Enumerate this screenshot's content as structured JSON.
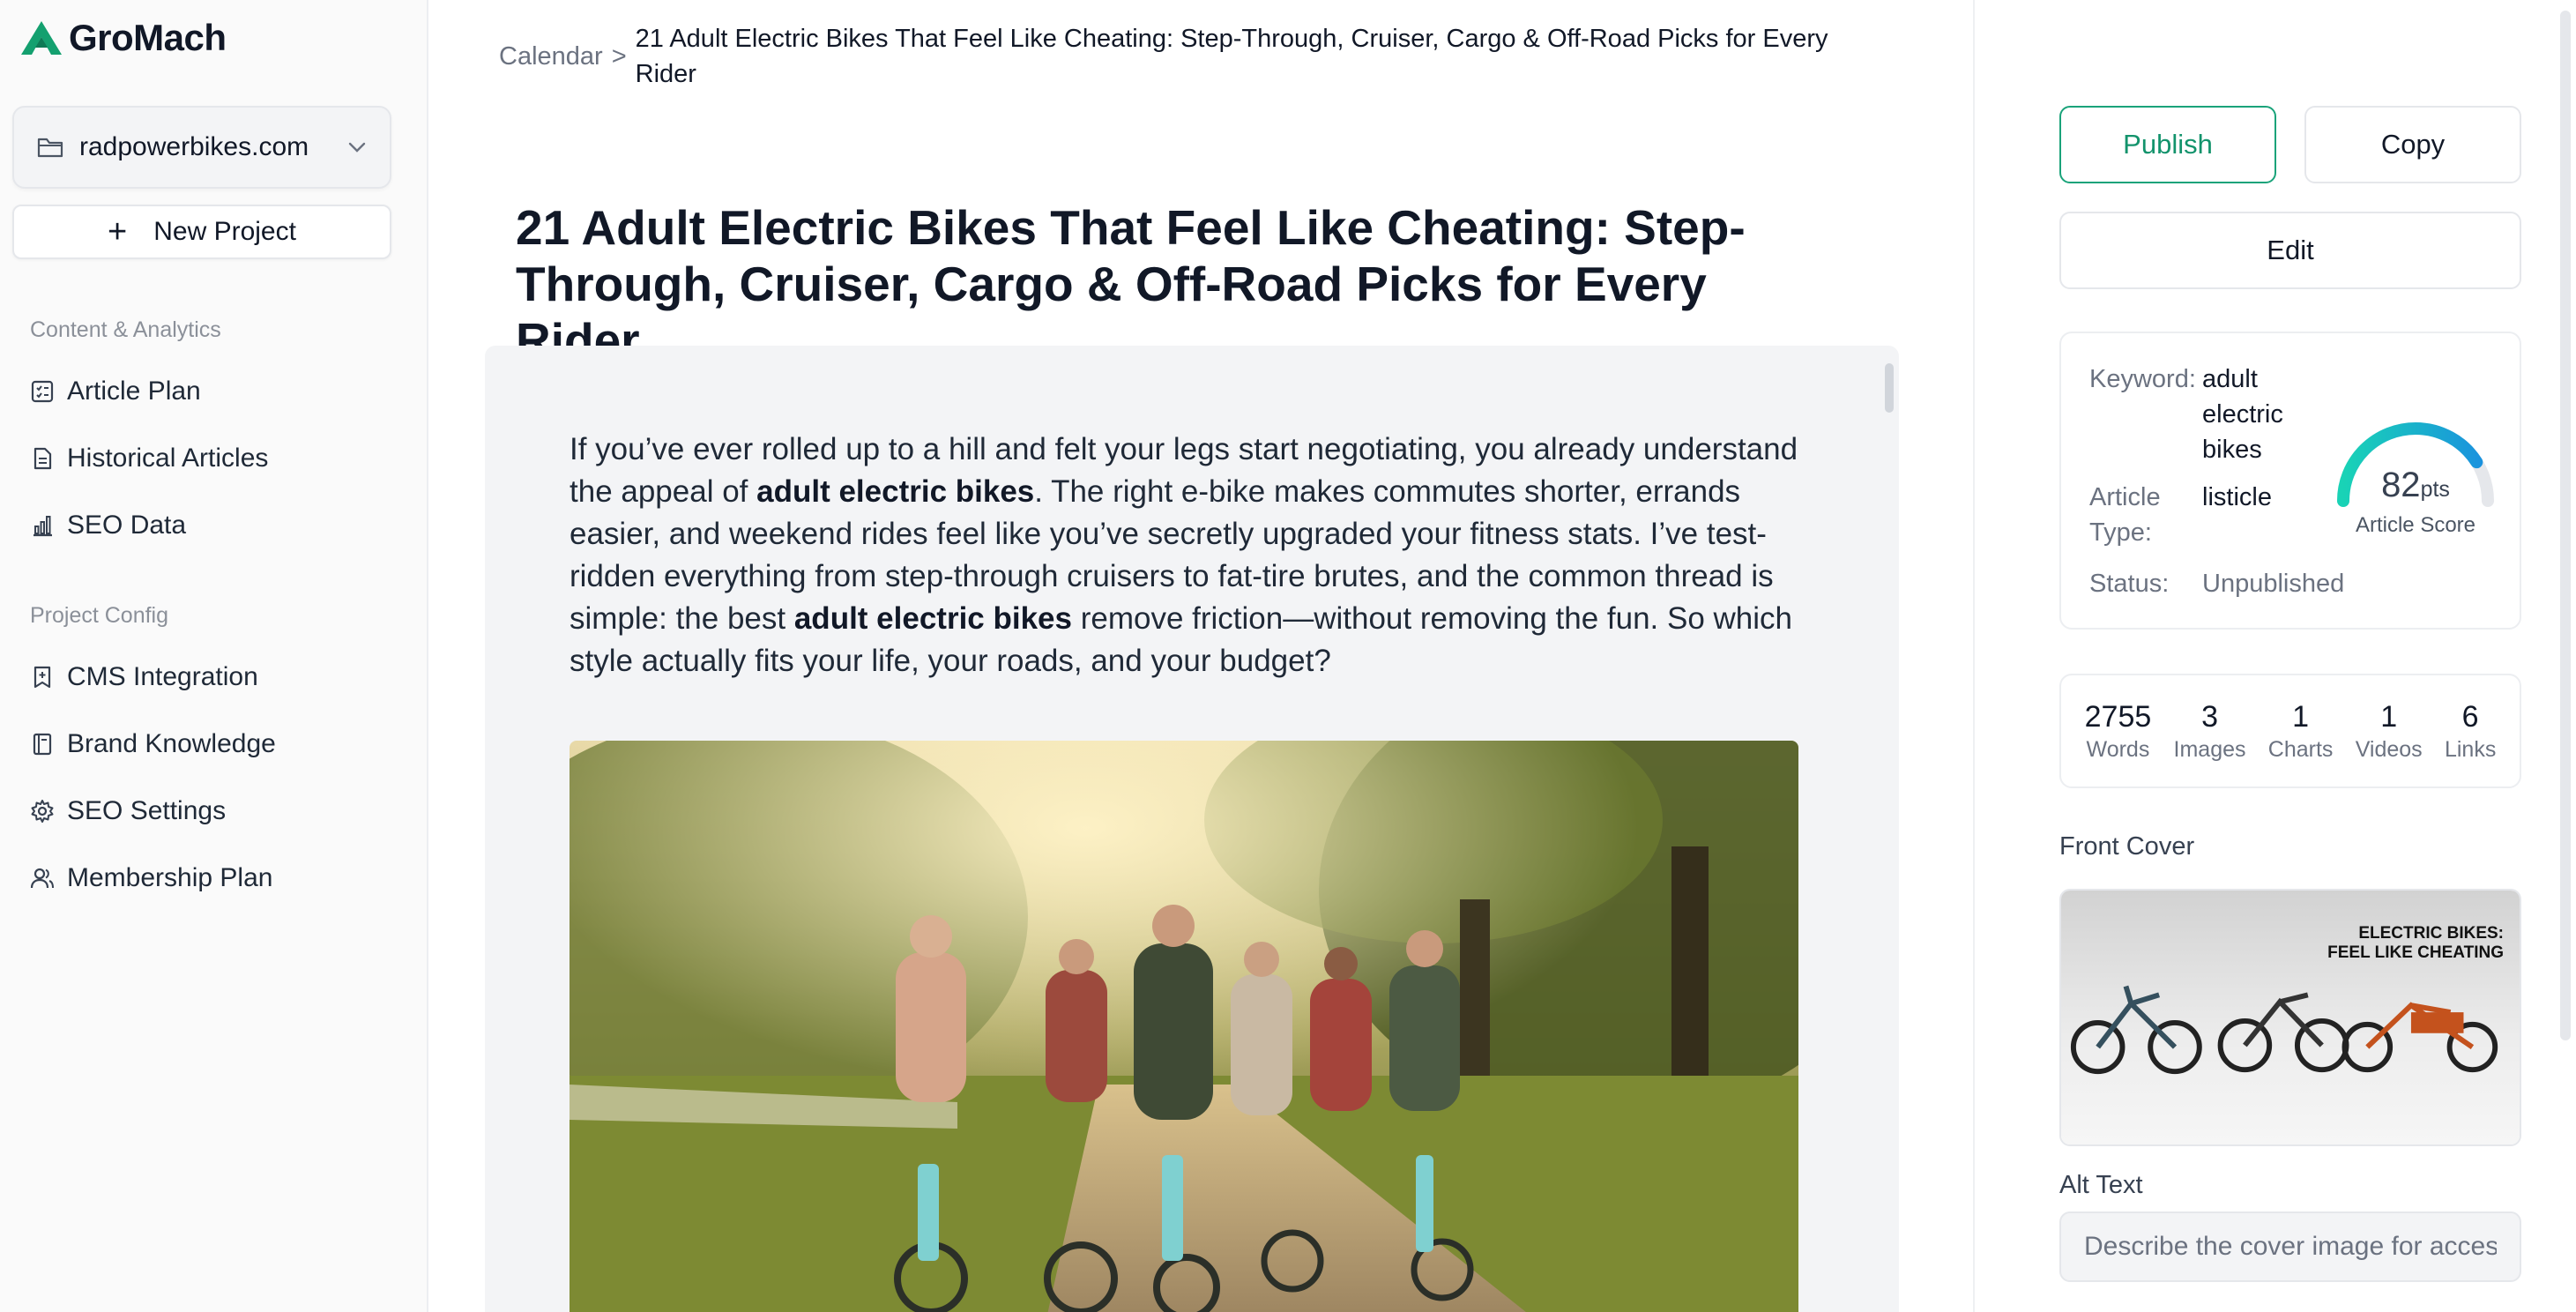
{
  "brand": {
    "name": "GroMach",
    "accent": "#14a06f"
  },
  "sidebar": {
    "project": "radpowerbikes.com",
    "new_project": "New Project",
    "sections": [
      {
        "title": "Content & Analytics",
        "items": [
          "Article Plan",
          "Historical Articles",
          "SEO Data"
        ]
      },
      {
        "title": "Project Config",
        "items": [
          "CMS Integration",
          "Brand Knowledge",
          "SEO Settings",
          "Membership Plan"
        ]
      }
    ]
  },
  "breadcrumb": {
    "root": "Calendar",
    "separator": ">",
    "current": "21 Adult Electric Bikes That Feel Like Cheating: Step-Through, Cruiser, Cargo & Off-Road Picks for Every Rider"
  },
  "article": {
    "title": "21 Adult Electric Bikes That Feel Like Cheating: Step-Through, Cruiser, Cargo & Off-Road Picks for Every Rider",
    "intro": [
      {
        "t": "If you’ve ever rolled up to a hill and felt your legs start negotiating, you already understand the appeal of "
      },
      {
        "t": "adult electric bikes",
        "b": true
      },
      {
        "t": ". The right e-bike makes commutes shorter, errands easier, and weekend rides feel like you’ve secretly upgraded your fitness stats. I’ve test-ridden everything from step-through cruisers to fat-tire brutes, and the common thread is simple: the best "
      },
      {
        "t": "adult electric bikes",
        "b": true
      },
      {
        "t": " remove friction—without removing the fun. So which style actually fits your life, your roads, and your budget?"
      }
    ]
  },
  "actions": {
    "publish": "Publish",
    "copy": "Copy",
    "edit": "Edit"
  },
  "info": {
    "keyword_label": "Keyword:",
    "keyword": "adult electric bikes",
    "type_label": "Article Type:",
    "type": "listicle",
    "status_label": "Status:",
    "status": "Unpublished",
    "score": "82",
    "score_unit": "pts",
    "score_value": 0.82,
    "score_label": "Article Score"
  },
  "stats": [
    {
      "n": "2755",
      "l": "Words"
    },
    {
      "n": "3",
      "l": "Images"
    },
    {
      "n": "1",
      "l": "Charts"
    },
    {
      "n": "1",
      "l": "Videos"
    },
    {
      "n": "6",
      "l": "Links"
    }
  ],
  "cover": {
    "label": "Front Cover",
    "text_line1": "ELECTRIC BIKES:",
    "text_line2": "FEEL LIKE CHEATING"
  },
  "alt_text": {
    "label": "Alt Text",
    "placeholder": "Describe the cover image for accessibility"
  }
}
